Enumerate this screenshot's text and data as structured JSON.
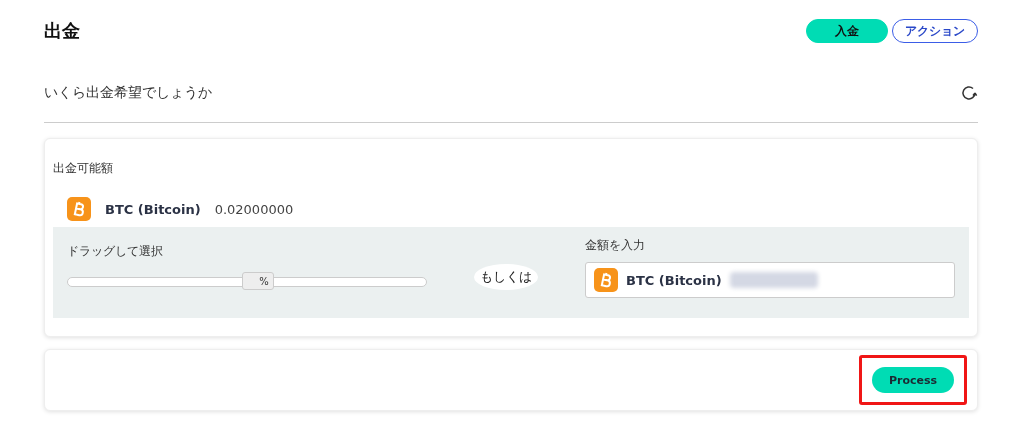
{
  "header": {
    "title": "出金",
    "buttons": [
      {
        "label": "入金",
        "kind": "primary"
      },
      {
        "label": "アクション",
        "kind": "outline"
      }
    ]
  },
  "question": "いくら出金希望でしょうか",
  "available": {
    "label": "出金可能額",
    "currency": "BTC (Bitcoin)",
    "amount": "0.02000000"
  },
  "slider": {
    "label": "ドラッグして選択",
    "level": 0.53,
    "unit": "%"
  },
  "separator": "もしくは",
  "amount_input": {
    "label": "金額を入力",
    "currency": "BTC (Bitcoin)"
  },
  "process_button": {
    "label": "Process",
    "highlighted": true
  }
}
